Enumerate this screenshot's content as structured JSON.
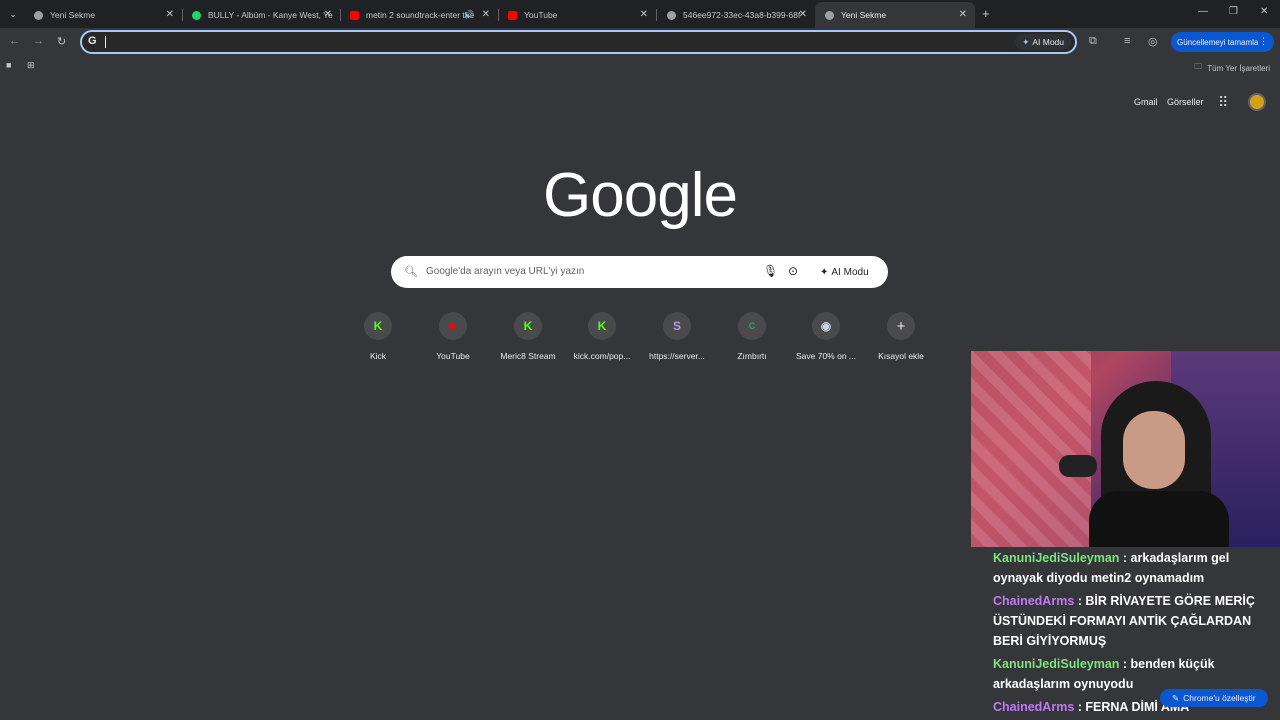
{
  "tabs": [
    {
      "title": "Yeni Sekme",
      "favicon_color": "#9aa0a6",
      "active": false
    },
    {
      "title": "BULLY - Albüm - Kanye West, Ye",
      "favicon_color": "#1ed760",
      "active": false
    },
    {
      "title": "metin 2 soundtrack-enter the",
      "favicon_color": "#ff0000",
      "active": false,
      "audio": true
    },
    {
      "title": "YouTube",
      "favicon_color": "#ff0000",
      "active": false
    },
    {
      "title": "546ee972-33ec-43a8-b399-68f",
      "favicon_color": "#9aa0a6",
      "active": false
    },
    {
      "title": "Yeni Sekme",
      "favicon_color": "#9aa0a6",
      "active": true
    }
  ],
  "icons": {
    "tab_search": "⌄",
    "close": "✕",
    "new_tab": "+",
    "minimize": "—",
    "restore": "❐",
    "window_close": "✕",
    "back": "←",
    "forward": "→",
    "reload": "↻",
    "audio": "🔊"
  },
  "omnibox": {
    "value": "",
    "ai_label": "AI Modu"
  },
  "toolbar": {
    "update_label": "Güncellemeyi tamamla"
  },
  "bookmarks": {
    "all_label": "Tüm Yer İşaretleri"
  },
  "header": {
    "gmail": "Gmail",
    "images": "Görseller"
  },
  "logo": "Google",
  "search": {
    "placeholder": "Google'da arayın veya URL'yi yazın",
    "ai_label": "AI Modu"
  },
  "shortcuts": [
    {
      "label": "Kick",
      "glyph": "K",
      "color": "#53fc18"
    },
    {
      "label": "YouTube",
      "glyph": "▶",
      "color": "#ff0000"
    },
    {
      "label": "Meric8 Stream",
      "glyph": "K",
      "color": "#53fc18"
    },
    {
      "label": "kick.com/pop...",
      "glyph": "K",
      "color": "#53fc18"
    },
    {
      "label": "https://server...",
      "glyph": "S",
      "color": "#b39ddb"
    },
    {
      "label": "Zımbırtı",
      "glyph": "C",
      "color": "#34a853"
    },
    {
      "label": "Save 70% on ...",
      "glyph": "◉",
      "color": "#c7d5e0"
    },
    {
      "label": "Kısayol ekle",
      "glyph": "+",
      "color": "#e8eaed"
    }
  ],
  "chat": [
    {
      "user": "KanuniJediSuleyman",
      "user_color": "green",
      "text": "arkadaşlarım gel oynayak diyodu metin2 oynamadım"
    },
    {
      "user": "ChainedArms",
      "user_color": "purple",
      "text": "BİR RİVAYETE GÖRE MERİÇ ÜSTÜNDEKİ FORMAYI ANTİK ÇAĞLARDAN BERİ GİYİYORMUŞ"
    },
    {
      "user": "KanuniJediSuleyman",
      "user_color": "green",
      "text": "benden küçük arkadaşlarım oynuyodu"
    },
    {
      "user": "ChainedArms",
      "user_color": "purple",
      "text": "FERNA DİMİ AMA"
    }
  ],
  "customize_label": "Chrome'u özelleştir"
}
